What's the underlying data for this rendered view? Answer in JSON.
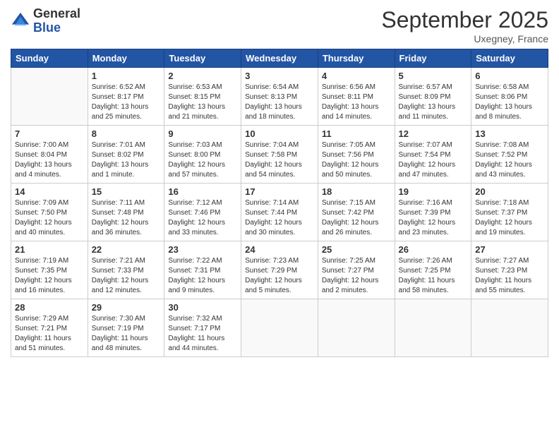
{
  "logo": {
    "general": "General",
    "blue": "Blue"
  },
  "title": "September 2025",
  "location": "Uxegney, France",
  "days_of_week": [
    "Sunday",
    "Monday",
    "Tuesday",
    "Wednesday",
    "Thursday",
    "Friday",
    "Saturday"
  ],
  "weeks": [
    [
      {
        "day": "",
        "sunrise": "",
        "sunset": "",
        "daylight": ""
      },
      {
        "day": "1",
        "sunrise": "Sunrise: 6:52 AM",
        "sunset": "Sunset: 8:17 PM",
        "daylight": "Daylight: 13 hours and 25 minutes."
      },
      {
        "day": "2",
        "sunrise": "Sunrise: 6:53 AM",
        "sunset": "Sunset: 8:15 PM",
        "daylight": "Daylight: 13 hours and 21 minutes."
      },
      {
        "day": "3",
        "sunrise": "Sunrise: 6:54 AM",
        "sunset": "Sunset: 8:13 PM",
        "daylight": "Daylight: 13 hours and 18 minutes."
      },
      {
        "day": "4",
        "sunrise": "Sunrise: 6:56 AM",
        "sunset": "Sunset: 8:11 PM",
        "daylight": "Daylight: 13 hours and 14 minutes."
      },
      {
        "day": "5",
        "sunrise": "Sunrise: 6:57 AM",
        "sunset": "Sunset: 8:09 PM",
        "daylight": "Daylight: 13 hours and 11 minutes."
      },
      {
        "day": "6",
        "sunrise": "Sunrise: 6:58 AM",
        "sunset": "Sunset: 8:06 PM",
        "daylight": "Daylight: 13 hours and 8 minutes."
      }
    ],
    [
      {
        "day": "7",
        "sunrise": "Sunrise: 7:00 AM",
        "sunset": "Sunset: 8:04 PM",
        "daylight": "Daylight: 13 hours and 4 minutes."
      },
      {
        "day": "8",
        "sunrise": "Sunrise: 7:01 AM",
        "sunset": "Sunset: 8:02 PM",
        "daylight": "Daylight: 13 hours and 1 minute."
      },
      {
        "day": "9",
        "sunrise": "Sunrise: 7:03 AM",
        "sunset": "Sunset: 8:00 PM",
        "daylight": "Daylight: 12 hours and 57 minutes."
      },
      {
        "day": "10",
        "sunrise": "Sunrise: 7:04 AM",
        "sunset": "Sunset: 7:58 PM",
        "daylight": "Daylight: 12 hours and 54 minutes."
      },
      {
        "day": "11",
        "sunrise": "Sunrise: 7:05 AM",
        "sunset": "Sunset: 7:56 PM",
        "daylight": "Daylight: 12 hours and 50 minutes."
      },
      {
        "day": "12",
        "sunrise": "Sunrise: 7:07 AM",
        "sunset": "Sunset: 7:54 PM",
        "daylight": "Daylight: 12 hours and 47 minutes."
      },
      {
        "day": "13",
        "sunrise": "Sunrise: 7:08 AM",
        "sunset": "Sunset: 7:52 PM",
        "daylight": "Daylight: 12 hours and 43 minutes."
      }
    ],
    [
      {
        "day": "14",
        "sunrise": "Sunrise: 7:09 AM",
        "sunset": "Sunset: 7:50 PM",
        "daylight": "Daylight: 12 hours and 40 minutes."
      },
      {
        "day": "15",
        "sunrise": "Sunrise: 7:11 AM",
        "sunset": "Sunset: 7:48 PM",
        "daylight": "Daylight: 12 hours and 36 minutes."
      },
      {
        "day": "16",
        "sunrise": "Sunrise: 7:12 AM",
        "sunset": "Sunset: 7:46 PM",
        "daylight": "Daylight: 12 hours and 33 minutes."
      },
      {
        "day": "17",
        "sunrise": "Sunrise: 7:14 AM",
        "sunset": "Sunset: 7:44 PM",
        "daylight": "Daylight: 12 hours and 30 minutes."
      },
      {
        "day": "18",
        "sunrise": "Sunrise: 7:15 AM",
        "sunset": "Sunset: 7:42 PM",
        "daylight": "Daylight: 12 hours and 26 minutes."
      },
      {
        "day": "19",
        "sunrise": "Sunrise: 7:16 AM",
        "sunset": "Sunset: 7:39 PM",
        "daylight": "Daylight: 12 hours and 23 minutes."
      },
      {
        "day": "20",
        "sunrise": "Sunrise: 7:18 AM",
        "sunset": "Sunset: 7:37 PM",
        "daylight": "Daylight: 12 hours and 19 minutes."
      }
    ],
    [
      {
        "day": "21",
        "sunrise": "Sunrise: 7:19 AM",
        "sunset": "Sunset: 7:35 PM",
        "daylight": "Daylight: 12 hours and 16 minutes."
      },
      {
        "day": "22",
        "sunrise": "Sunrise: 7:21 AM",
        "sunset": "Sunset: 7:33 PM",
        "daylight": "Daylight: 12 hours and 12 minutes."
      },
      {
        "day": "23",
        "sunrise": "Sunrise: 7:22 AM",
        "sunset": "Sunset: 7:31 PM",
        "daylight": "Daylight: 12 hours and 9 minutes."
      },
      {
        "day": "24",
        "sunrise": "Sunrise: 7:23 AM",
        "sunset": "Sunset: 7:29 PM",
        "daylight": "Daylight: 12 hours and 5 minutes."
      },
      {
        "day": "25",
        "sunrise": "Sunrise: 7:25 AM",
        "sunset": "Sunset: 7:27 PM",
        "daylight": "Daylight: 12 hours and 2 minutes."
      },
      {
        "day": "26",
        "sunrise": "Sunrise: 7:26 AM",
        "sunset": "Sunset: 7:25 PM",
        "daylight": "Daylight: 11 hours and 58 minutes."
      },
      {
        "day": "27",
        "sunrise": "Sunrise: 7:27 AM",
        "sunset": "Sunset: 7:23 PM",
        "daylight": "Daylight: 11 hours and 55 minutes."
      }
    ],
    [
      {
        "day": "28",
        "sunrise": "Sunrise: 7:29 AM",
        "sunset": "Sunset: 7:21 PM",
        "daylight": "Daylight: 11 hours and 51 minutes."
      },
      {
        "day": "29",
        "sunrise": "Sunrise: 7:30 AM",
        "sunset": "Sunset: 7:19 PM",
        "daylight": "Daylight: 11 hours and 48 minutes."
      },
      {
        "day": "30",
        "sunrise": "Sunrise: 7:32 AM",
        "sunset": "Sunset: 7:17 PM",
        "daylight": "Daylight: 11 hours and 44 minutes."
      },
      {
        "day": "",
        "sunrise": "",
        "sunset": "",
        "daylight": ""
      },
      {
        "day": "",
        "sunrise": "",
        "sunset": "",
        "daylight": ""
      },
      {
        "day": "",
        "sunrise": "",
        "sunset": "",
        "daylight": ""
      },
      {
        "day": "",
        "sunrise": "",
        "sunset": "",
        "daylight": ""
      }
    ]
  ]
}
